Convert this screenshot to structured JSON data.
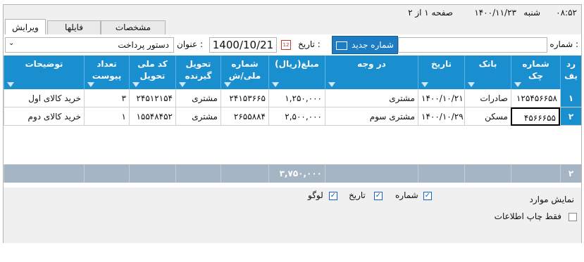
{
  "info": {
    "time": "۰۸:۵۲",
    "weekday": "شنبه",
    "date": "۱۴۰۰/۱۱/۲۳",
    "page_of": "صفحه ۱ از ۲"
  },
  "tabs": [
    "ویرایش",
    "فایلها",
    "مشخصات"
  ],
  "form": {
    "number_label": "شماره :",
    "number_value": "",
    "new_number_button": "شماره جدید",
    "date_label": "تاریخ :",
    "date_value": "1400/10/21",
    "title_label": "عنوان :",
    "title_value": "دستور پرداخت"
  },
  "grid": {
    "headers": [
      {
        "key": "row",
        "label": "رد\nیف"
      },
      {
        "key": "check_no",
        "label": "شماره\nچک"
      },
      {
        "key": "bank",
        "label": "بانک"
      },
      {
        "key": "date",
        "label": "تاریخ"
      },
      {
        "key": "in_favor",
        "label": "در وجه"
      },
      {
        "key": "amount",
        "label": "مبلغ(ریال)"
      },
      {
        "key": "national_id",
        "label": "شماره\nملی/ش"
      },
      {
        "key": "receiver",
        "label": "تحویل\nگیرنده"
      },
      {
        "key": "deliverer_id",
        "label": "کد ملی\nتحویل"
      },
      {
        "key": "attachments",
        "label": "تعداد\nپیوست"
      },
      {
        "key": "description",
        "label": "توضیحات"
      }
    ],
    "rows": [
      {
        "row": "۱",
        "check_no": "۱۲۵۴۵۶۶۵۸",
        "bank": "صادرات",
        "date": "۱۴۰۰/۱۰/۲۱",
        "in_favor": "مشتری",
        "amount": "۱,۲۵۰,۰۰۰",
        "national_id": "۲۴۱۵۳۶۶۵",
        "receiver": "مشتری",
        "deliverer_id": "۲۴۵۱۲۱۵۴",
        "attachments": "۳",
        "description": "خرید کالای اول"
      },
      {
        "row": "۲",
        "check_no": "۴۵۶۶۶۵۵",
        "bank": "مسکن",
        "date": "۱۴۰۰/۱۰/۲۹",
        "in_favor": "مشتری سوم",
        "amount": "۲,۵۰۰,۰۰۰",
        "national_id": "۲۶۵۵۸۸۴",
        "receiver": "مشتری",
        "deliverer_id": "۱۵۵۴۸۴۵۲",
        "attachments": "۱",
        "description": "خرید کالای دوم"
      }
    ],
    "footer": {
      "row_count": "۲",
      "amount_total": "۳,۷۵۰,۰۰۰"
    }
  },
  "options": {
    "show_items_label": "نمایش موارد",
    "number_label": "شماره",
    "date_label": "تاریخ",
    "logo_label": "لوگو",
    "number_checked": true,
    "date_checked": true,
    "logo_checked": true,
    "print_info_only_label": "فقط چاپ اطلاعات",
    "print_info_only_checked": false
  }
}
